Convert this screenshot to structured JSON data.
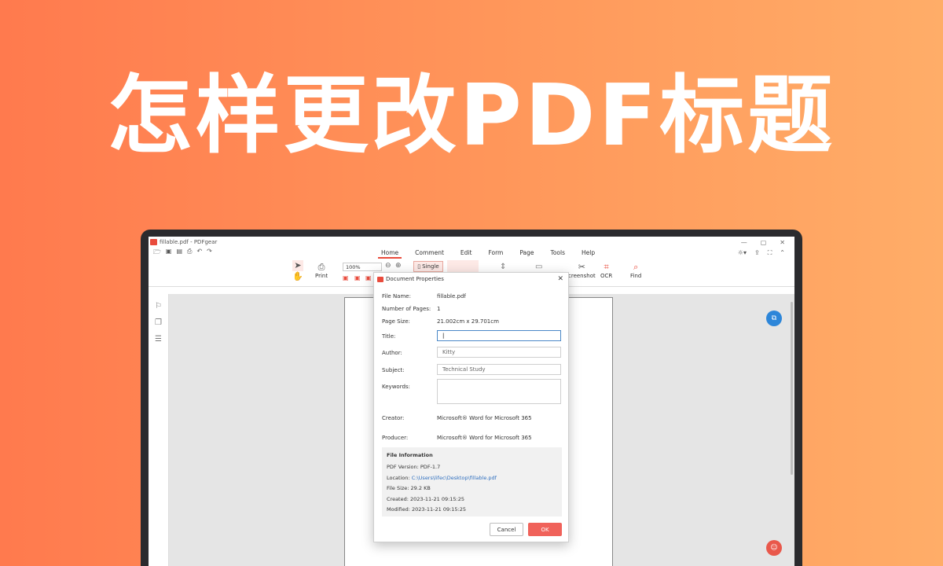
{
  "headline": "怎样更改PDF标题",
  "app": {
    "window_title": "fillable.pdf - PDFgear",
    "window_controls": [
      "—",
      "▢",
      "✕"
    ],
    "menu_tabs": [
      "Home",
      "Comment",
      "Edit",
      "Form",
      "Page",
      "Tools",
      "Help"
    ],
    "active_tab": "Home"
  },
  "ribbon": {
    "print": "Print",
    "zoom": "100%",
    "single": "Single",
    "screenshot": "creenshot",
    "ocr": "OCR",
    "find": "Find"
  },
  "dialog": {
    "title": "Document Properties",
    "file_name_label": "File Name:",
    "file_name": "fillable.pdf",
    "pages_label": "Number of Pages:",
    "pages": "1",
    "size_label": "Page Size:",
    "size": "21.002cm x 29.701cm",
    "title_label": "Title:",
    "title_value": "",
    "author_label": "Author:",
    "author": "Kitty",
    "subject_label": "Subject:",
    "subject": "Technical Study",
    "keywords_label": "Keywords:",
    "keywords": "",
    "creator_label": "Creator:",
    "creator": "Microsoft® Word for Microsoft 365",
    "producer_label": "Producer:",
    "producer": "Microsoft® Word for Microsoft 365",
    "info": {
      "heading": "File Information",
      "pdf_version": "PDF Version: PDF-1.7",
      "location_label": "Location: ",
      "location": "C:\\Users\\lifec\\Desktop\\fillable.pdf",
      "file_size": "File Size: 29.2 KB",
      "created": "Created: 2023-11-21 09:15:25",
      "modified": "Modified: 2023-11-21 09:15:25"
    },
    "cancel": "Cancel",
    "ok": "OK"
  },
  "colors": {
    "accent": "#E94B3C",
    "ok_button": "#F0625A",
    "link": "#2F6FBF",
    "float_blue": "#2D86D9",
    "float_red": "#E9584B"
  }
}
